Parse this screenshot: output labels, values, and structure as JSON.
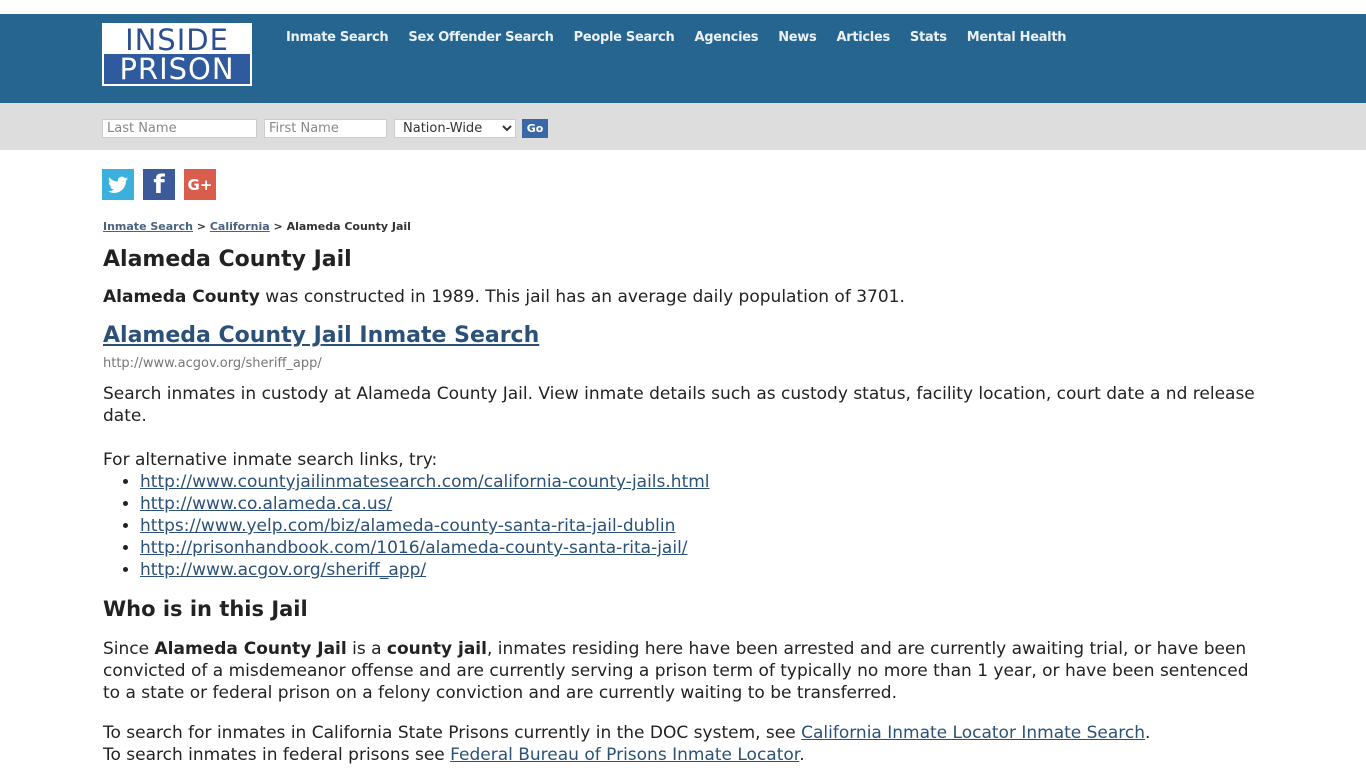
{
  "header": {
    "logo_top": "INSIDE",
    "logo_bottom": "PRISON",
    "nav": [
      "Inmate Search",
      "Sex Offender Search",
      "People Search",
      "Agencies",
      "News",
      "Articles",
      "Stats",
      "Mental Health"
    ]
  },
  "search": {
    "last_name_placeholder": "Last Name",
    "first_name_placeholder": "First Name",
    "scope_selected": "Nation-Wide",
    "go_label": "Go"
  },
  "social": {
    "twitter_glyph": "🐦",
    "facebook_glyph": "f",
    "google_glyph": "G+"
  },
  "breadcrumb": {
    "items": [
      "Inmate Search",
      "California"
    ],
    "separator": ">",
    "current": "Alameda County Jail"
  },
  "page": {
    "title": "Alameda County Jail",
    "intro_bold": "Alameda County",
    "intro_rest": " was constructed in 1989. This jail has an average daily population of 3701.",
    "search_link": "Alameda County Jail Inmate Search",
    "search_url": "http://www.acgov.org/sheriff_app/",
    "search_desc": "Search inmates in custody at Alameda County Jail. View inmate details such as custody status, facility location, court date a nd release date.",
    "alt_intro": "For alternative inmate search links, try:",
    "alt_links": [
      "http://www.countyjailinmatesearch.com/california-county-jails.html",
      "http://www.co.alameda.ca.us/",
      "https://www.yelp.com/biz/alameda-county-santa-rita-jail-dublin",
      "http://prisonhandbook.com/1016/alameda-county-santa-rita-jail/",
      "http://www.acgov.org/sheriff_app/"
    ],
    "who_heading": "Who is in this Jail",
    "who_p1": "Since ",
    "who_b1": "Alameda County Jail",
    "who_p2": " is a ",
    "who_b2": "county jail",
    "who_p3": ", inmates residing here have been arrested and are currently awaiting trial, or have been convicted of a misdemeanor offense and are currently serving a prison term of typically no more than 1 year, or have been sentenced to a state or federal prison on a felony conviction and are currently waiting to be transferred.",
    "state_text": "To search for inmates in California State Prisons currently in the DOC system, see ",
    "state_link": "California Inmate Locator Inmate Search",
    "state_end": ".",
    "fed_text": "To search inmates in federal prisons see ",
    "fed_link": "Federal Bureau of Prisons Inmate Locator",
    "fed_end": "."
  }
}
